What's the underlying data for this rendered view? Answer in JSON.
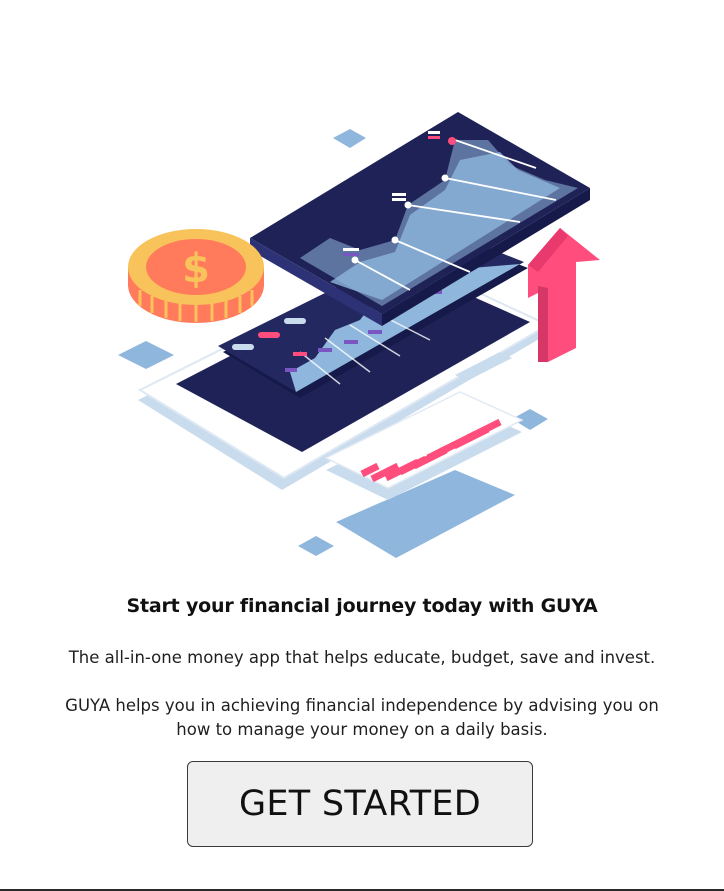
{
  "hero": {
    "coin_symbol": "$"
  },
  "content": {
    "headline": "Start your financial journey today with GUYA",
    "tagline": "The all-in-one money app that helps educate, budget, save and invest.",
    "description": "GUYA helps you in achieving financial independence by advising you on how to manage your money on a daily basis."
  },
  "cta": {
    "label": "GET STARTED"
  },
  "colors": {
    "navy": "#1f2257",
    "pink": "#ff4e7d",
    "light_blue": "#8fb6dd",
    "coin_gold": "#f8c35a",
    "coin_orange": "#ff7b5c"
  }
}
